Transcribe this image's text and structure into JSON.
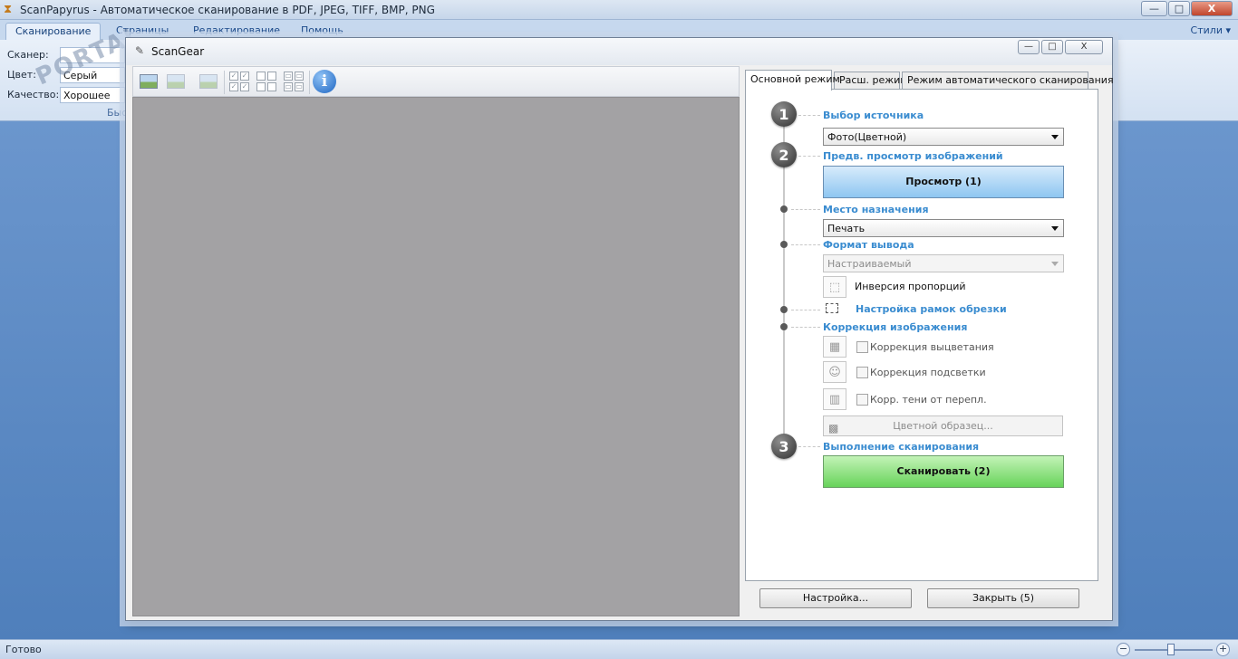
{
  "main_window": {
    "title": "ScanPapyrus - Автоматическое сканирование в PDF, JPEG, TIFF, BMP, PNG",
    "controls": {
      "minimize": "—",
      "maximize": "□",
      "close": "X"
    }
  },
  "ribbon": {
    "tabs": [
      "Сканирование",
      "Страницы",
      "Редактирование",
      "Помощь"
    ],
    "styles_label": "Стили",
    "styles_arrow": "▾",
    "fields": [
      {
        "label": "Сканер:",
        "value": ""
      },
      {
        "label": "Цвет:",
        "value": "Серый"
      },
      {
        "label": "Качество:",
        "value": "Хорошее"
      }
    ],
    "group_caption": "Быс"
  },
  "watermark": "PORTAL",
  "status_bar": {
    "text": "Готово",
    "zoom_minus": "−",
    "zoom_plus": "+"
  },
  "dialog": {
    "title": "ScanGear",
    "controls": {
      "minimize": "—",
      "maximize": "□",
      "close": "X"
    },
    "tabs": [
      "Основной режим",
      "Расш. режим",
      "Режим автоматического сканирования"
    ],
    "toolbar_info": "i",
    "steps": [
      "1",
      "2",
      "3"
    ],
    "source": {
      "label": "Выбор источника",
      "value": "Фото(Цветной)"
    },
    "preview": {
      "label": "Предв. просмотр изображений",
      "button": "Просмотр (1)"
    },
    "destination": {
      "label": "Место назначения",
      "value": "Печать"
    },
    "output": {
      "label": "Формат вывода",
      "value": "Настраиваемый"
    },
    "invert_ratio": "Инверсия пропорций",
    "crop_frames": "Настройка рамок обрезки",
    "correction": {
      "label": "Коррекция изображения",
      "options": [
        "Коррекция выцветания",
        "Коррекция подсветки",
        "Корр. тени от перепл."
      ]
    },
    "color_pattern": "Цветной образец...",
    "scan": {
      "label": "Выполнение сканирования",
      "button": "Сканировать (2)"
    },
    "bottom_buttons": {
      "settings": "Настройка...",
      "close": "Закрыть (5)"
    }
  }
}
